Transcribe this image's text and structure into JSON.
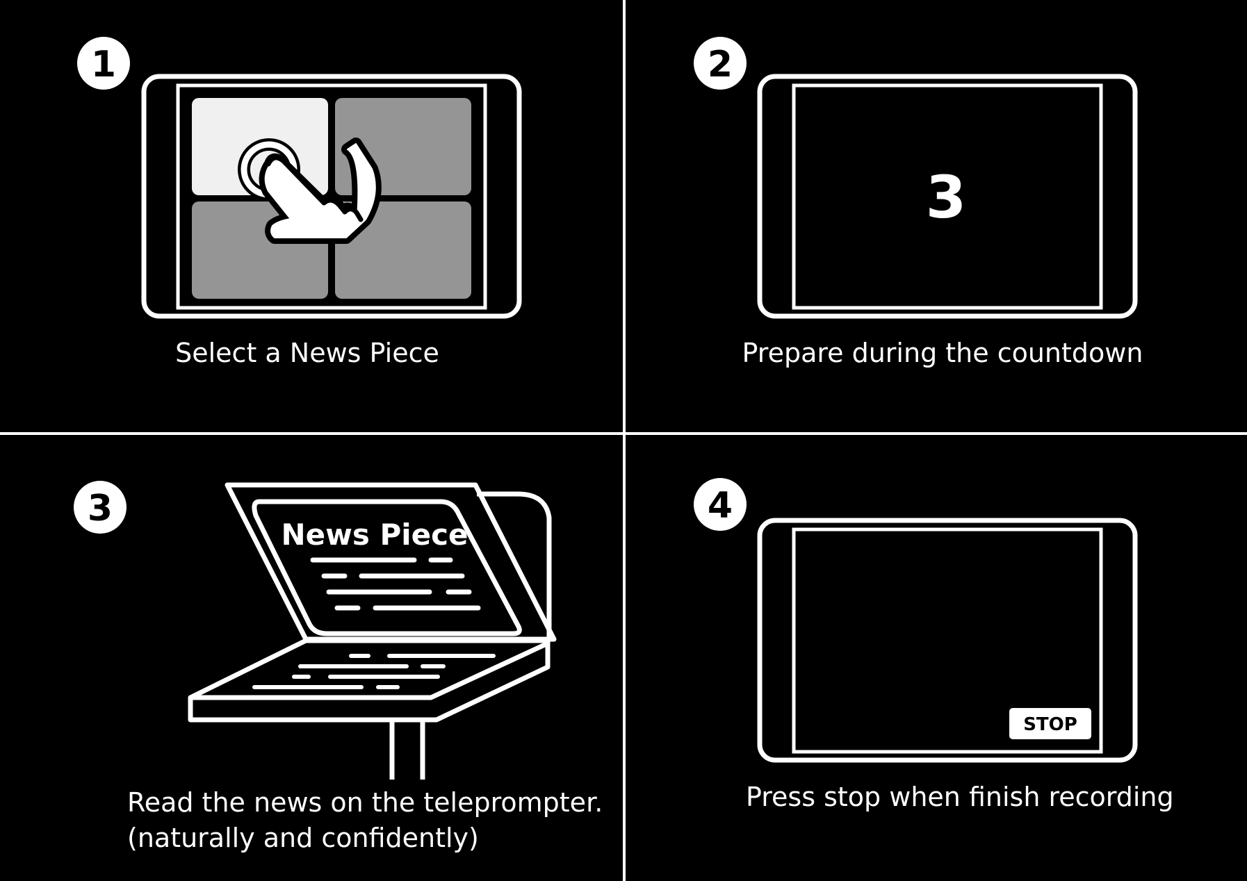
{
  "steps": [
    {
      "number": "1",
      "caption": "Select a News Piece"
    },
    {
      "number": "2",
      "caption": "Prepare during the countdown",
      "countdown": "3"
    },
    {
      "number": "3",
      "caption_line1": "Read the news on the teleprompter.",
      "caption_line2": "(naturally and confidently)",
      "prompter_title": "News Piece"
    },
    {
      "number": "4",
      "caption": "Press stop when finish recording",
      "stop_label": "STOP"
    }
  ],
  "colors": {
    "background": "#000000",
    "foreground": "#ffffff",
    "tile_selected": "#f0f0f0",
    "tile_default": "#959595"
  }
}
